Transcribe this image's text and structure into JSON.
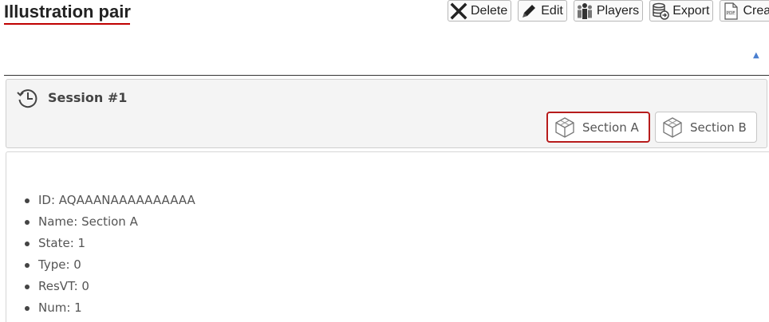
{
  "header": {
    "title": "Illustration pair"
  },
  "toolbar": {
    "delete_label": "Delete",
    "edit_label": "Edit",
    "players_label": "Players",
    "export_label": "Export",
    "create_label": "Crea"
  },
  "collapse_arrow": "▲",
  "session": {
    "title": "Session #1",
    "sections": [
      {
        "label": "Section A",
        "selected": true
      },
      {
        "label": "Section B",
        "selected": false
      }
    ]
  },
  "details": {
    "items": [
      "ID: AQAAANAAAAAAAAAA",
      "Name: Section A",
      "State: 1",
      "Type: 0",
      "ResVT: 0",
      "Num: 1"
    ]
  },
  "colors": {
    "accent_red": "#c00000",
    "selected_border": "#b71c1c",
    "panel_bg": "#f4f4f4",
    "arrow_blue": "#4a7fd0"
  }
}
